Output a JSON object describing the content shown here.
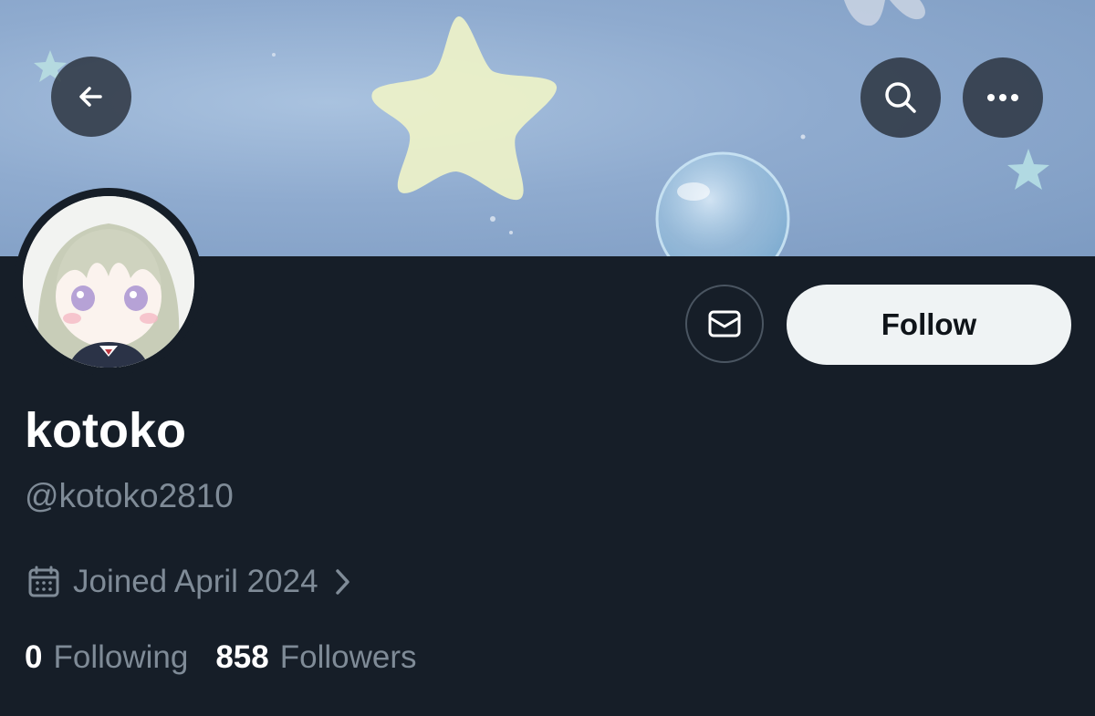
{
  "header": {
    "back_icon": "arrow-left-icon",
    "search_icon": "search-icon",
    "more_icon": "more-horizontal-icon"
  },
  "profile": {
    "display_name": "kotoko",
    "handle": "@kotoko2810",
    "joined": "Joined April 2024",
    "following_count": "0",
    "following_label": "Following",
    "followers_count": "858",
    "followers_label": "Followers"
  },
  "actions": {
    "message_icon": "envelope-icon",
    "follow_label": "Follow"
  },
  "colors": {
    "background": "#15202b",
    "follow_button_bg": "#eff3f4",
    "secondary_text": "#7f8b97"
  }
}
